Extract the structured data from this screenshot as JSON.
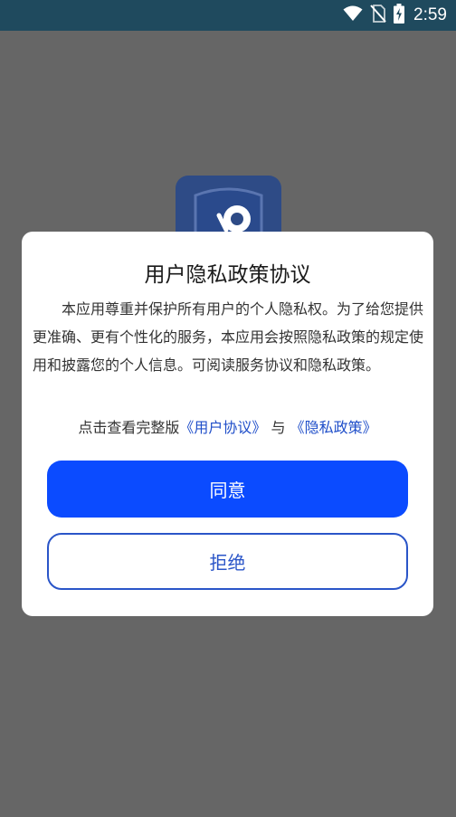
{
  "status_bar": {
    "time": "2:59",
    "icons": [
      "wifi-icon",
      "no-sim-icon",
      "battery-charging-icon"
    ]
  },
  "app": {
    "logo_icon": "shield-camera-icon"
  },
  "dialog": {
    "title": "用户隐私政策协议",
    "body": "本应用尊重并保护所有用户的个人隐私权。为了给您提供更准确、更有个性化的服务，本应用会按照隐私政策的规定使用和披露您的个人信息。可阅读服务协议和隐私政策。",
    "links_prefix": "点击查看完整版",
    "user_agreement_link": "《用户协议》",
    "links_joiner": "与",
    "privacy_policy_link": "《隐私政策》",
    "agree_label": "同意",
    "reject_label": "拒绝"
  },
  "colors": {
    "overlay_bg": "#666666",
    "status_bar_bg": "#1f4a5e",
    "primary": "#0b4bff",
    "link": "#1f4ec9"
  }
}
